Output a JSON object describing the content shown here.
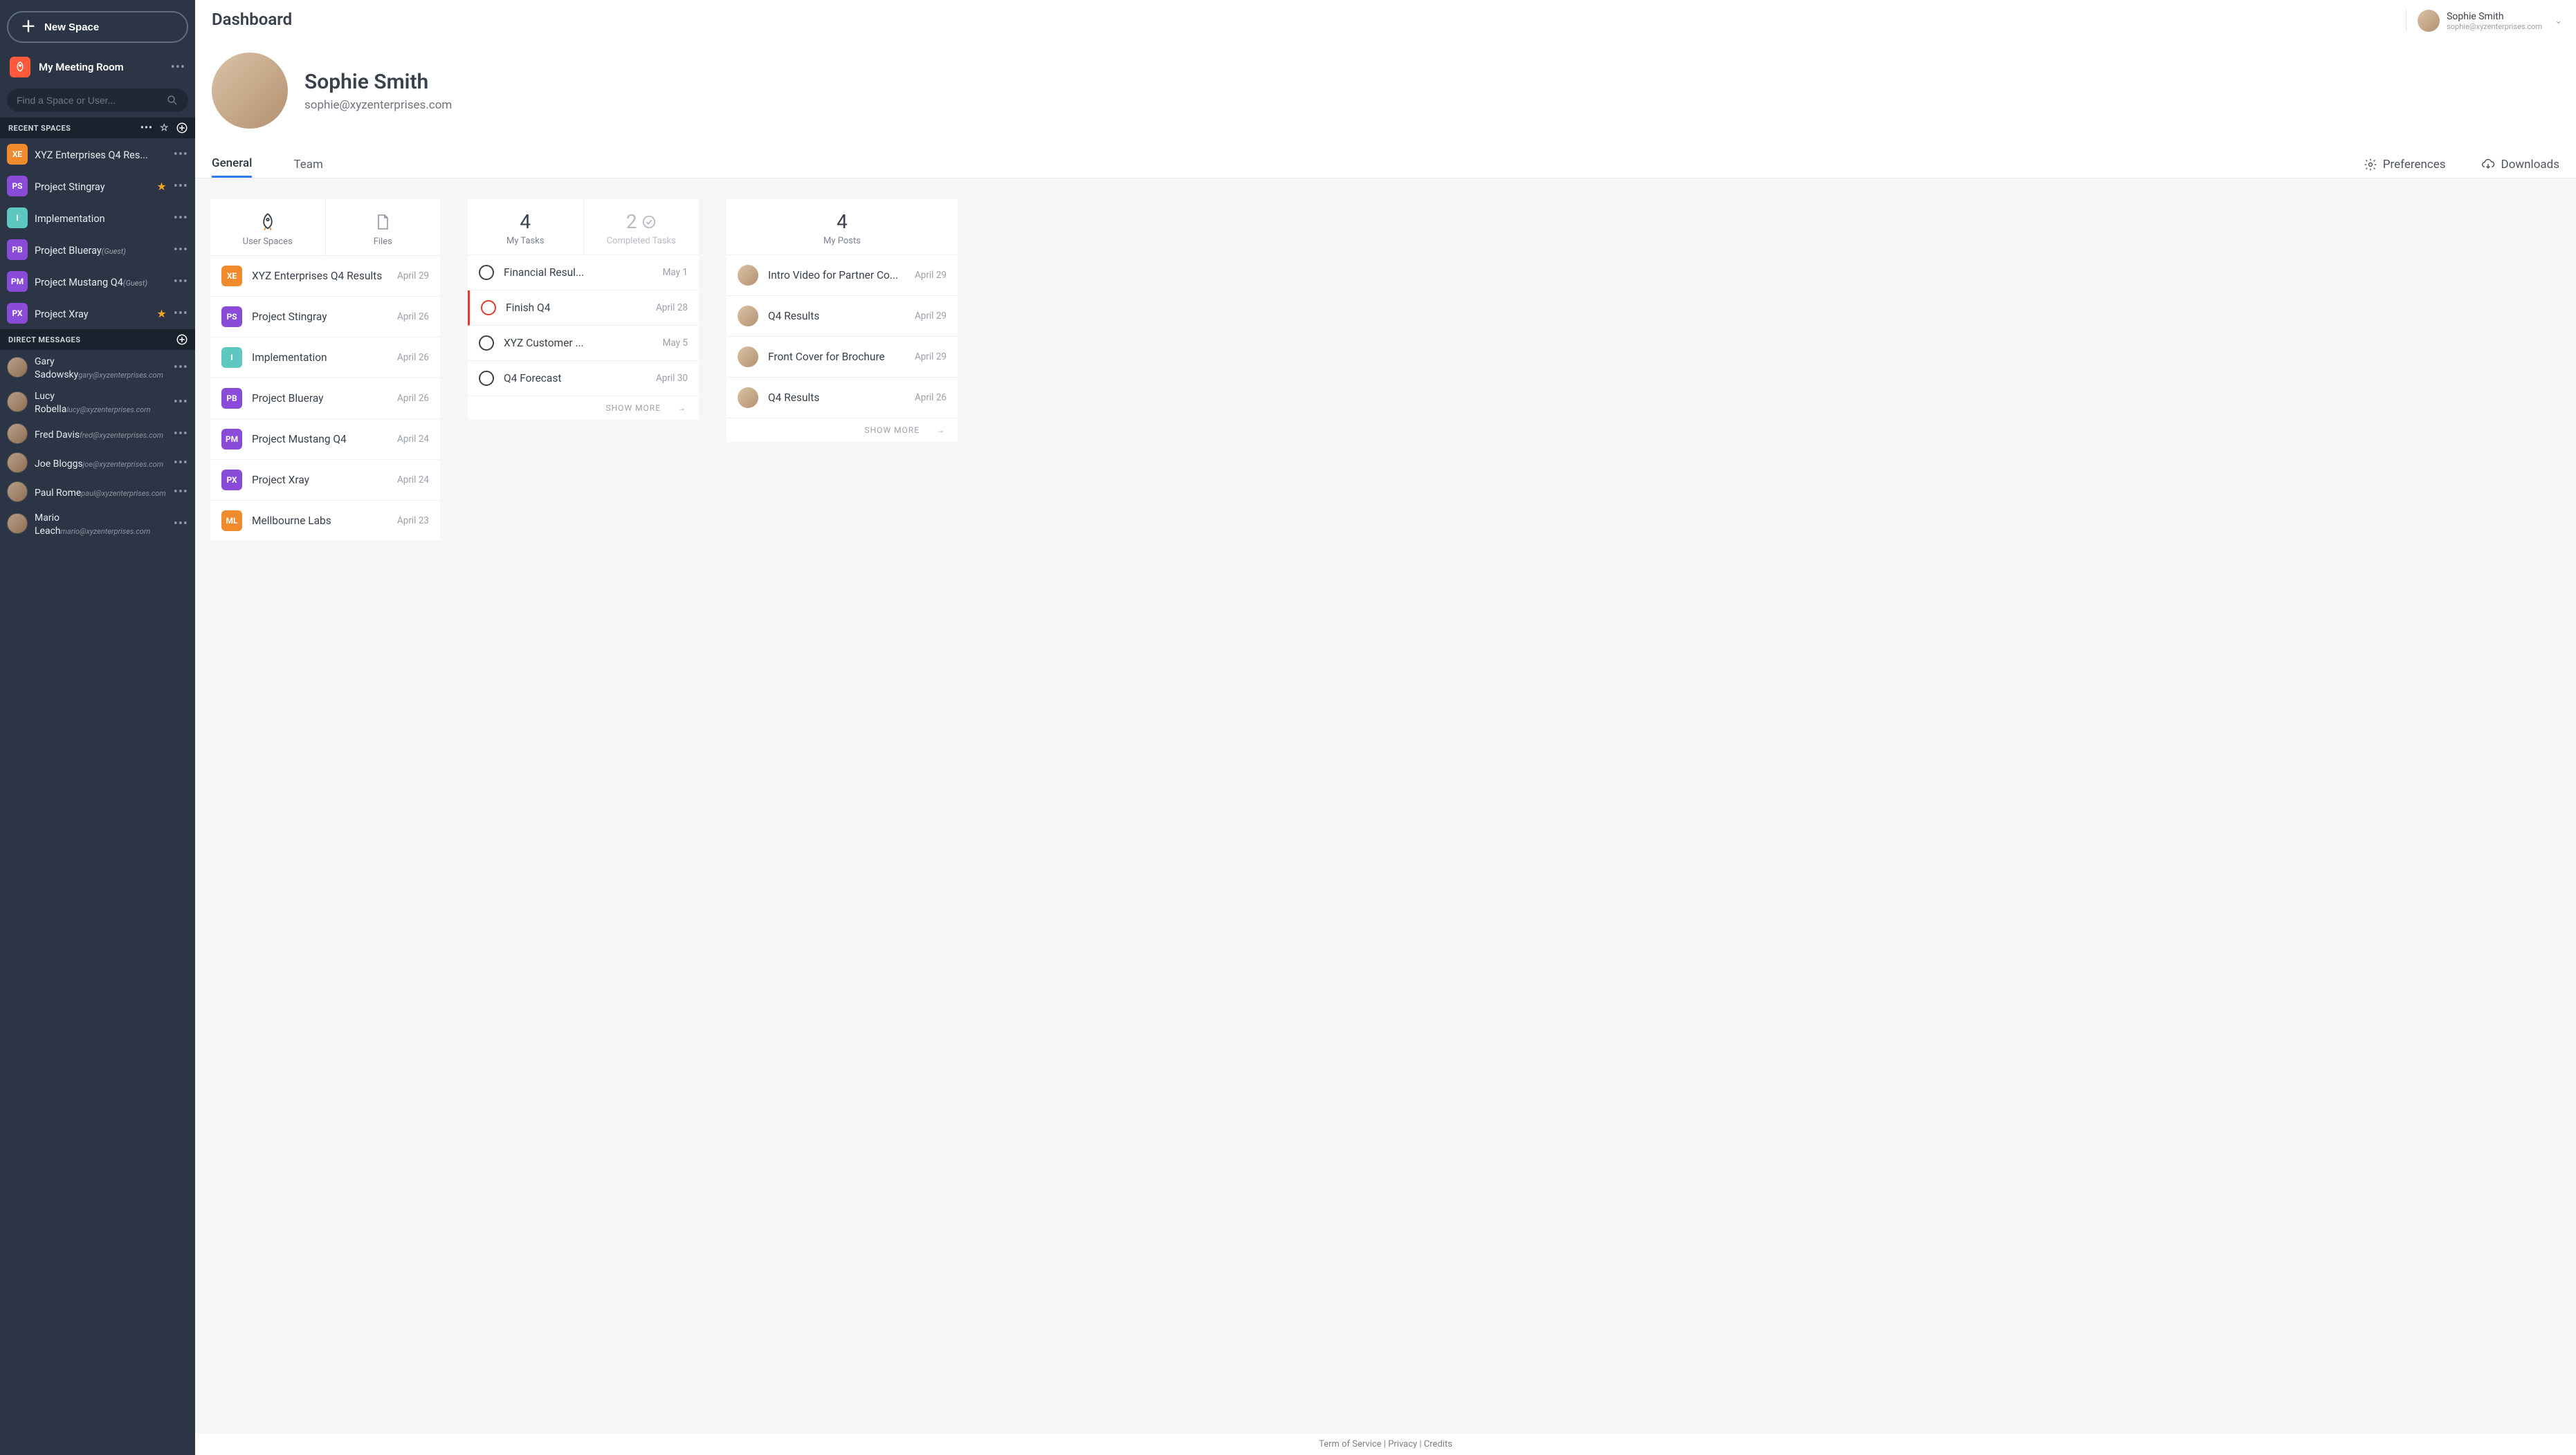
{
  "sidebar": {
    "new_space_label": "New Space",
    "meeting_room_label": "My Meeting Room",
    "search_placeholder": "Find a Space or User...",
    "recent_spaces_header": "RECENT SPACES",
    "direct_messages_header": "DIRECT MESSAGES",
    "spaces": [
      {
        "initials": "XE",
        "color": "#f08a2c",
        "name": "XYZ Enterprises Q4 Res...",
        "starred": false,
        "guest": false
      },
      {
        "initials": "PS",
        "color": "#8a4bd9",
        "name": "Project Stingray",
        "starred": true,
        "guest": false
      },
      {
        "initials": "I",
        "color": "#5ec7c0",
        "name": "Implementation",
        "starred": false,
        "guest": false
      },
      {
        "initials": "PB",
        "color": "#8a4bd9",
        "name": "Project Blueray",
        "starred": false,
        "guest": true
      },
      {
        "initials": "PM",
        "color": "#8a4bd9",
        "name": "Project Mustang Q4",
        "starred": false,
        "guest": true
      },
      {
        "initials": "PX",
        "color": "#8a4bd9",
        "name": "Project Xray",
        "starred": true,
        "guest": false
      }
    ],
    "guest_label": "(Guest)",
    "directs": [
      {
        "name": "Gary Sadowsky",
        "email": "gary@xyzenterprises.com"
      },
      {
        "name": "Lucy Robella",
        "email": "lucy@xyzenterprises.com"
      },
      {
        "name": "Fred Davis",
        "email": "fred@xyzenterprises.com"
      },
      {
        "name": "Joe Bloggs",
        "email": "joe@xyzenterprises.com"
      },
      {
        "name": "Paul Rome",
        "email": "paul@xyzenterprises.com"
      },
      {
        "name": "Mario Leach",
        "email": "mario@xyzenterprises.com"
      }
    ]
  },
  "header": {
    "page_title": "Dashboard",
    "account_name": "Sophie Smith",
    "account_email": "sophie@xyzenterprises.com"
  },
  "profile": {
    "name": "Sophie Smith",
    "email": "sophie@xyzenterprises.com"
  },
  "tabs": {
    "general": "General",
    "team": "Team",
    "preferences": "Preferences",
    "downloads": "Downloads"
  },
  "cards": {
    "user_spaces_label": "User Spaces",
    "files_label": "Files",
    "my_tasks_count": "4",
    "my_tasks_label": "My Tasks",
    "completed_count": "2",
    "completed_label": "Completed Tasks",
    "my_posts_count": "4",
    "my_posts_label": "My Posts",
    "show_more_label": "SHOW MORE"
  },
  "user_spaces": [
    {
      "initials": "XE",
      "color": "#f08a2c",
      "name": "XYZ Enterprises Q4 Results",
      "date": "April 29"
    },
    {
      "initials": "PS",
      "color": "#8a4bd9",
      "name": "Project Stingray",
      "date": "April 26"
    },
    {
      "initials": "I",
      "color": "#5ec7c0",
      "name": "Implementation",
      "date": "April 26"
    },
    {
      "initials": "PB",
      "color": "#8a4bd9",
      "name": "Project Blueray",
      "date": "April 26"
    },
    {
      "initials": "PM",
      "color": "#8a4bd9",
      "name": "Project Mustang Q4",
      "date": "April 24"
    },
    {
      "initials": "PX",
      "color": "#8a4bd9",
      "name": "Project Xray",
      "date": "April 24"
    },
    {
      "initials": "ML",
      "color": "#f08a2c",
      "name": "Mellbourne Labs",
      "date": "April 23"
    }
  ],
  "tasks": [
    {
      "name": "Financial Resul...",
      "date": "May 1",
      "overdue": false
    },
    {
      "name": "Finish Q4",
      "date": "April 28",
      "overdue": true
    },
    {
      "name": "XYZ Customer ...",
      "date": "May 5",
      "overdue": false
    },
    {
      "name": "Q4 Forecast",
      "date": "April 30",
      "overdue": false
    }
  ],
  "posts": [
    {
      "name": "Intro Video for Partner Co...",
      "date": "April 29"
    },
    {
      "name": "Q4 Results",
      "date": "April 29"
    },
    {
      "name": "Front Cover for Brochure",
      "date": "April 29"
    },
    {
      "name": "Q4 Results",
      "date": "April 26"
    }
  ],
  "footer": {
    "tos": "Term of Service",
    "privacy": "Privacy",
    "credits": "Credits"
  }
}
